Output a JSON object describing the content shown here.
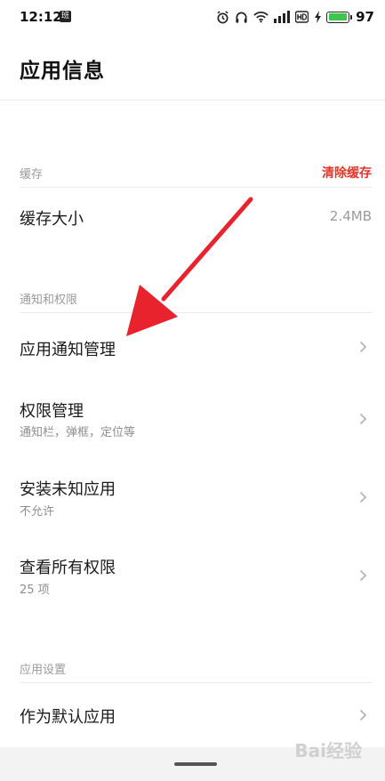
{
  "status_bar": {
    "time": "12:12",
    "notification_icon": "notification-app-icon",
    "notification_glyph": "班",
    "icons": [
      "alarm-icon",
      "headphones-icon",
      "wifi-icon",
      "signal-icon",
      "hd-icon",
      "charging-icon"
    ],
    "battery_percent": 97,
    "battery_text": "97",
    "battery_color": "#3ac64a"
  },
  "page": {
    "title": "应用信息"
  },
  "cache_section": {
    "label": "缓存",
    "action_label": "清除缓存",
    "action_color": "#e5352b",
    "size_label": "缓存大小",
    "size_value": "2.4MB"
  },
  "permissions_section": {
    "label": "通知和权限",
    "items": [
      {
        "title": "应用通知管理",
        "subtitle": ""
      },
      {
        "title": "权限管理",
        "subtitle": "通知栏，弹框，定位等"
      },
      {
        "title": "安装未知应用",
        "subtitle": "不允许"
      },
      {
        "title": "查看所有权限",
        "subtitle": "25 项"
      }
    ]
  },
  "settings_section": {
    "label": "应用设置",
    "items": [
      {
        "title": "作为默认应用"
      }
    ]
  },
  "annotation": {
    "arrow_color": "#e8232e"
  },
  "watermark": {
    "text": "Bai经验"
  }
}
